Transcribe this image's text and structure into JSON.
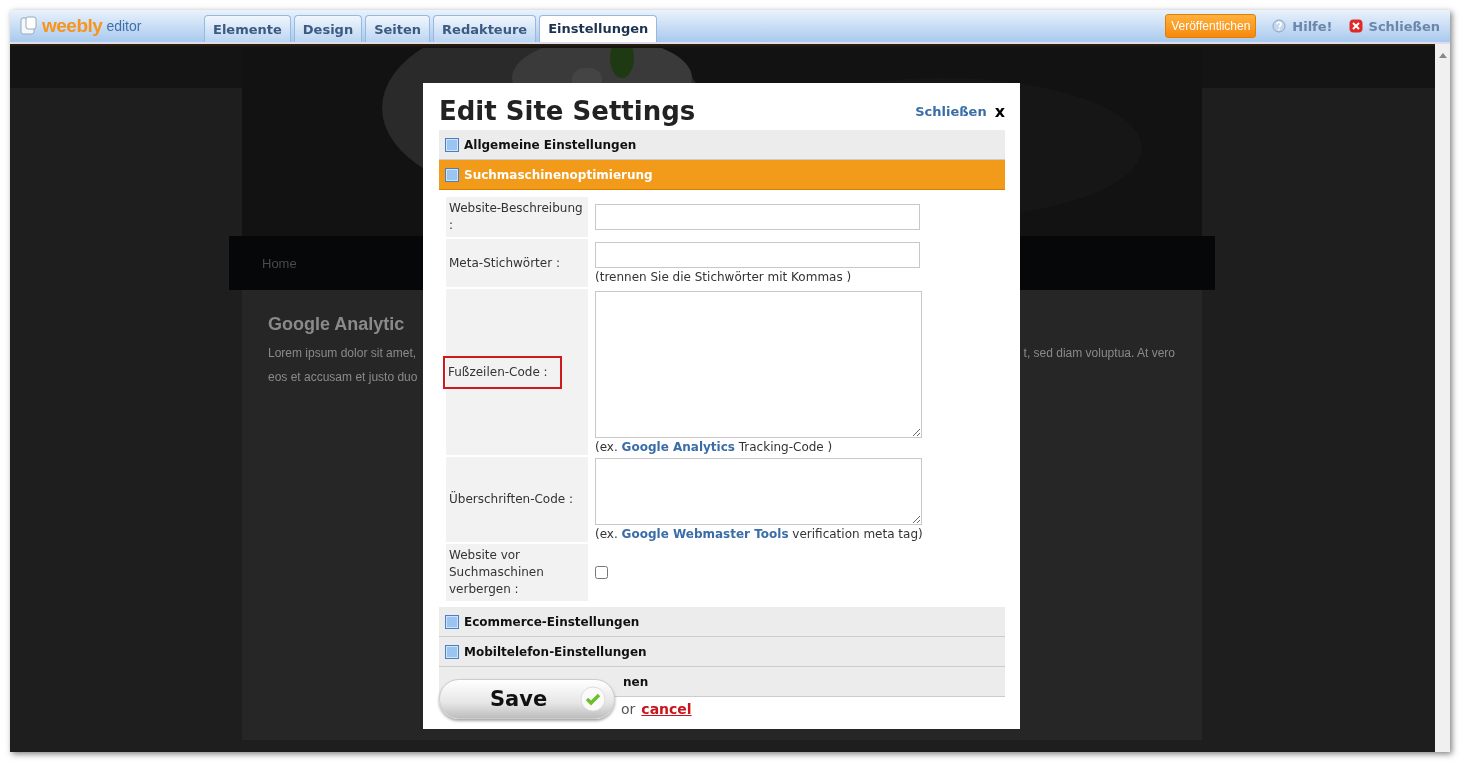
{
  "topbar": {
    "logo": "weebly",
    "logo_suffix": "editor",
    "tabs": [
      {
        "label": "Elemente",
        "selected": false
      },
      {
        "label": "Design",
        "selected": false
      },
      {
        "label": "Seiten",
        "selected": false
      },
      {
        "label": "Redakteure",
        "selected": false
      },
      {
        "label": "Einstellungen",
        "selected": true
      }
    ],
    "publish": "Veröffentlichen",
    "help": "Hilfe!",
    "close": "Schließen"
  },
  "site": {
    "nav": "Home",
    "heading": "Google Analytic",
    "lines_left": [
      "Lorem ipsum dolor sit amet,",
      "eos et accusam et justo duo"
    ],
    "line_right": "t, sed diam voluptua. At vero"
  },
  "dialog": {
    "title": "Edit Site Settings",
    "close_link": "Schließen",
    "close_x": "x",
    "sections": [
      {
        "label": "Allgemeine Einstellungen",
        "expanded": false
      },
      {
        "label": "Suchmaschinenoptimierung",
        "expanded": true,
        "fields": [
          {
            "kind": "text",
            "label": "Website-Beschreibung :",
            "highlighted": false
          },
          {
            "kind": "text",
            "label": "Meta-Stichwörter :",
            "highlighted": false,
            "hint": {
              "before": "(trennen Sie die Stichwörter mit Kommas )"
            }
          },
          {
            "kind": "bigtextarea",
            "label": "Fußzeilen-Code :",
            "highlighted": true,
            "hint": {
              "before": "(ex. ",
              "link": "Google Analytics",
              "after": " Tracking-Code )"
            }
          },
          {
            "kind": "textarea",
            "label": "Überschriften-Code :",
            "highlighted": false,
            "hint": {
              "before": "(ex. ",
              "link": "Google Webmaster Tools",
              "after": " verification meta tag)"
            }
          },
          {
            "kind": "checkbox",
            "label": "Website vor Suchmaschinen verbergen :",
            "highlighted": false,
            "checked": false
          }
        ]
      },
      {
        "label": "Ecommerce-Einstellungen",
        "expanded": false
      },
      {
        "label": "Mobiltelefon-Einstellungen",
        "expanded": false
      },
      {
        "label": "nen",
        "expanded": false
      }
    ],
    "save": "Save",
    "or": "or",
    "cancel": "cancel"
  }
}
